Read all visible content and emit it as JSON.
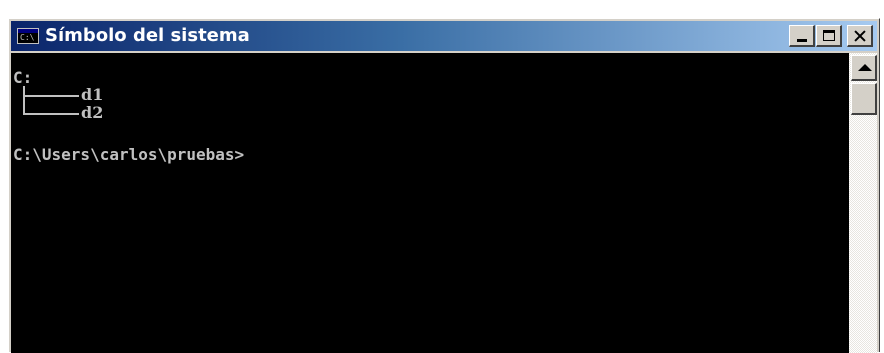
{
  "window": {
    "title": "Símbolo del sistema",
    "icon": "cmd-icon",
    "icon_text": "C:\\",
    "controls": [
      "minimize-icon",
      "maximize-icon",
      "close-icon"
    ]
  },
  "console": {
    "drive_line": "C:",
    "tree": [
      "d1",
      "d2"
    ],
    "prompt": "C:\\Users\\carlos\\pruebas>"
  },
  "colors": {
    "title_start": "#0a246a",
    "title_end": "#a6caf0",
    "console_bg": "#000000",
    "console_fg": "#c0c0c0"
  }
}
